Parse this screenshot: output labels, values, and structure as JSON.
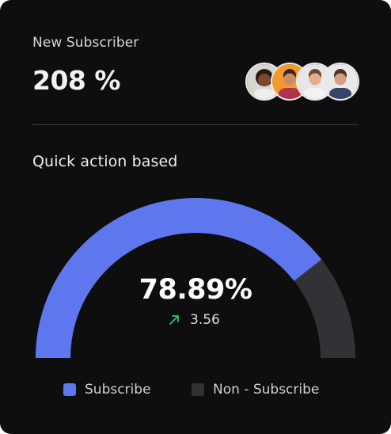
{
  "card": {
    "label": "New Subscriber",
    "value": "208 %",
    "avatars": [
      "person-1-avatar",
      "person-2-avatar",
      "person-3-avatar",
      "person-4-avatar"
    ]
  },
  "section": {
    "title": "Quick action based"
  },
  "gauge": {
    "percent": 78.89,
    "value_label": "78.89%",
    "delta_value": "3.56",
    "delta_icon": "arrow-up-right-icon",
    "colors": {
      "subscribe": "#5f77ee",
      "non_subscribe": "#323236",
      "delta": "#2fc76b"
    }
  },
  "legend": {
    "subscribe": "Subscribe",
    "non_subscribe": "Non - Subscribe"
  }
}
